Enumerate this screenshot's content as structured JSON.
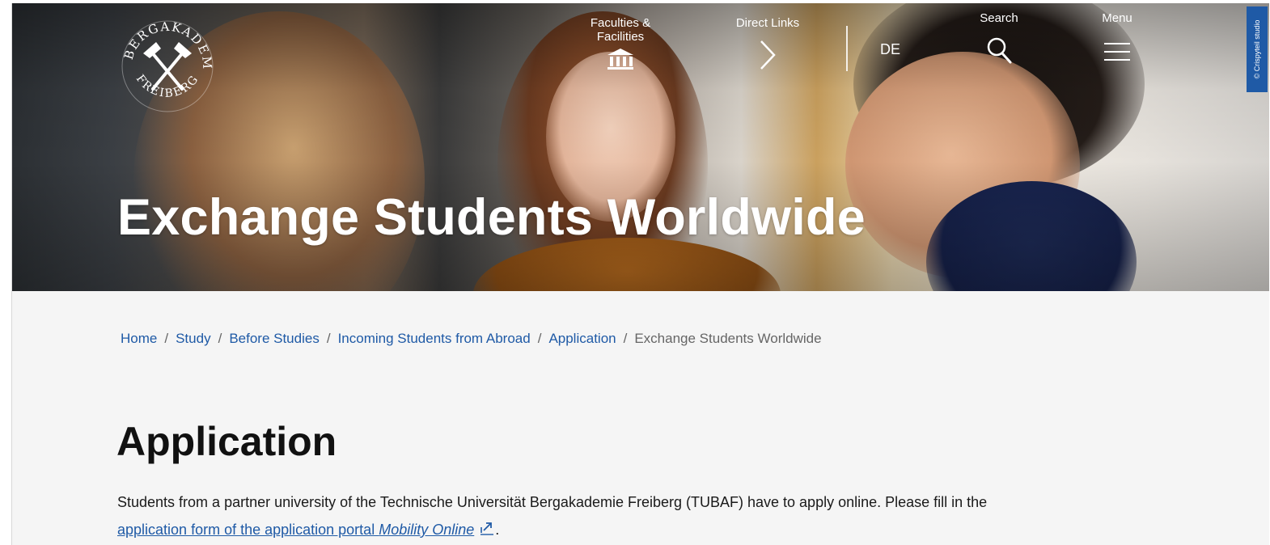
{
  "header": {
    "nav": {
      "faculties_label": "Faculties & Facilities",
      "direct_links_label": "Direct Links",
      "search_label": "Search",
      "menu_label": "Menu",
      "language": "DE"
    },
    "icons": {
      "logo": "university-logo-icon",
      "faculties": "building-columns-icon",
      "direct_links": "chevron-right-icon",
      "search": "search-icon",
      "menu": "hamburger-menu-icon"
    },
    "hero_title": "Exchange Students Worldwide",
    "copyright_label": "© Crispyteil studio"
  },
  "breadcrumb": {
    "items": [
      {
        "label": "Home"
      },
      {
        "label": "Study"
      },
      {
        "label": "Before Studies"
      },
      {
        "label": "Incoming Students from Abroad"
      },
      {
        "label": "Application"
      }
    ],
    "separator": "/",
    "current": "Exchange Students Worldwide"
  },
  "content": {
    "heading": "Application",
    "paragraph": {
      "text_before": "Students from a partner university of the Technische Universität Bergakademie Freiberg (TUBAF) have to apply online. Please fill in the ",
      "link_text": "application form of the application portal ",
      "link_emphasis": "Mobility Online",
      "text_after": "."
    }
  },
  "colors": {
    "link": "#1f5aa6",
    "heading": "#111111",
    "page_bg": "#f5f5f5",
    "copyright_bg": "#1f5aa6"
  }
}
